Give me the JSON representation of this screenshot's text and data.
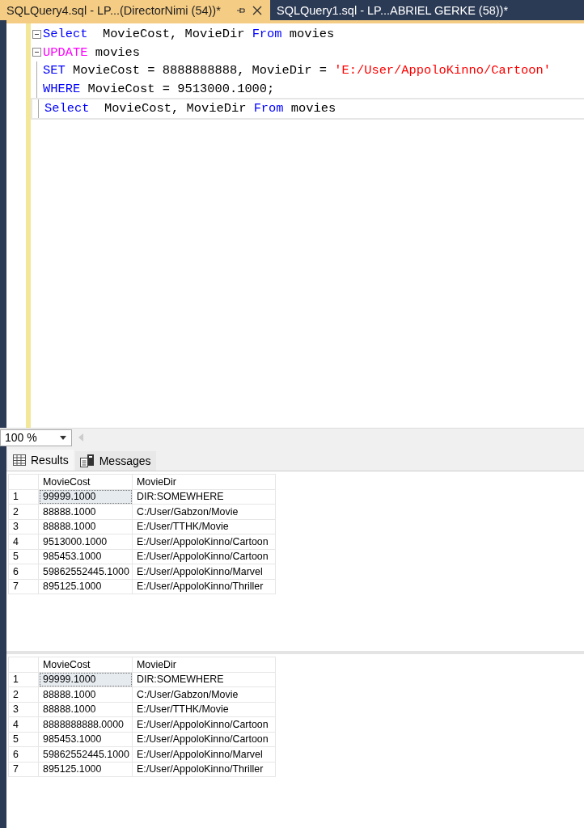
{
  "tabs": [
    {
      "label": "SQLQuery4.sql - LP...(DirectorNimi (54))*",
      "selected": true
    },
    {
      "label": "SQLQuery1.sql - LP...ABRIEL GERKE (58))*",
      "selected": false
    }
  ],
  "editor": {
    "lines": [
      {
        "fold": true,
        "current": false,
        "tokens": [
          {
            "kind": "keyword",
            "text": "Select"
          },
          {
            "kind": "plain",
            "text": "  MovieCost, MovieDir "
          },
          {
            "kind": "keyword",
            "text": "From"
          },
          {
            "kind": "plain",
            "text": " movies"
          }
        ]
      },
      {
        "fold": true,
        "current": false,
        "tokens": [
          {
            "kind": "dml",
            "text": "UPDATE"
          },
          {
            "kind": "plain",
            "text": " movies"
          }
        ]
      },
      {
        "fold": false,
        "current": false,
        "tokens": [
          {
            "kind": "keyword",
            "text": "SET"
          },
          {
            "kind": "plain",
            "text": " MovieCost = 8888888888, MovieDir = "
          },
          {
            "kind": "string",
            "text": "'E:/User/AppoloKinno/Cartoon'"
          }
        ]
      },
      {
        "fold": false,
        "current": false,
        "tokens": [
          {
            "kind": "keyword",
            "text": "WHERE"
          },
          {
            "kind": "plain",
            "text": " MovieCost = 9513000.1000;"
          }
        ]
      },
      {
        "fold": false,
        "current": true,
        "tokens": [
          {
            "kind": "keyword",
            "text": "Select"
          },
          {
            "kind": "plain",
            "text": "  MovieCost, MovieDir "
          },
          {
            "kind": "keyword",
            "text": "From"
          },
          {
            "kind": "plain",
            "text": " movies"
          }
        ]
      }
    ]
  },
  "zoom": {
    "value": "100 %"
  },
  "result_tabs": [
    {
      "label": "Results",
      "selected": true
    },
    {
      "label": "Messages",
      "selected": false
    }
  ],
  "grids": [
    {
      "columns": [
        "MovieCost",
        "MovieDir"
      ],
      "rows": [
        {
          "number": "1",
          "cells": [
            "99999.1000",
            "DIR:SOMEWHERE"
          ],
          "selected": true
        },
        {
          "number": "2",
          "cells": [
            "88888.1000",
            "C:/User/Gabzon/Movie"
          ],
          "selected": false
        },
        {
          "number": "3",
          "cells": [
            "88888.1000",
            "E:/User/TTHK/Movie"
          ],
          "selected": false
        },
        {
          "number": "4",
          "cells": [
            "9513000.1000",
            "E:/User/AppoloKinno/Cartoon"
          ],
          "selected": false
        },
        {
          "number": "5",
          "cells": [
            "985453.1000",
            "E:/User/AppoloKinno/Cartoon"
          ],
          "selected": false
        },
        {
          "number": "6",
          "cells": [
            "59862552445.1000",
            "E:/User/AppoloKinno/Marvel"
          ],
          "selected": false
        },
        {
          "number": "7",
          "cells": [
            "895125.1000",
            "E:/User/AppoloKinno/Thriller"
          ],
          "selected": false
        }
      ]
    },
    {
      "columns": [
        "MovieCost",
        "MovieDir"
      ],
      "rows": [
        {
          "number": "1",
          "cells": [
            "99999.1000",
            "DIR:SOMEWHERE"
          ],
          "selected": true
        },
        {
          "number": "2",
          "cells": [
            "88888.1000",
            "C:/User/Gabzon/Movie"
          ],
          "selected": false
        },
        {
          "number": "3",
          "cells": [
            "88888.1000",
            "E:/User/TTHK/Movie"
          ],
          "selected": false
        },
        {
          "number": "4",
          "cells": [
            "8888888888.0000",
            "E:/User/AppoloKinno/Cartoon"
          ],
          "selected": false
        },
        {
          "number": "5",
          "cells": [
            "985453.1000",
            "E:/User/AppoloKinno/Cartoon"
          ],
          "selected": false
        },
        {
          "number": "6",
          "cells": [
            "59862552445.1000",
            "E:/User/AppoloKinno/Marvel"
          ],
          "selected": false
        },
        {
          "number": "7",
          "cells": [
            "895125.1000",
            "E:/User/AppoloKinno/Thriller"
          ],
          "selected": false
        }
      ]
    }
  ]
}
